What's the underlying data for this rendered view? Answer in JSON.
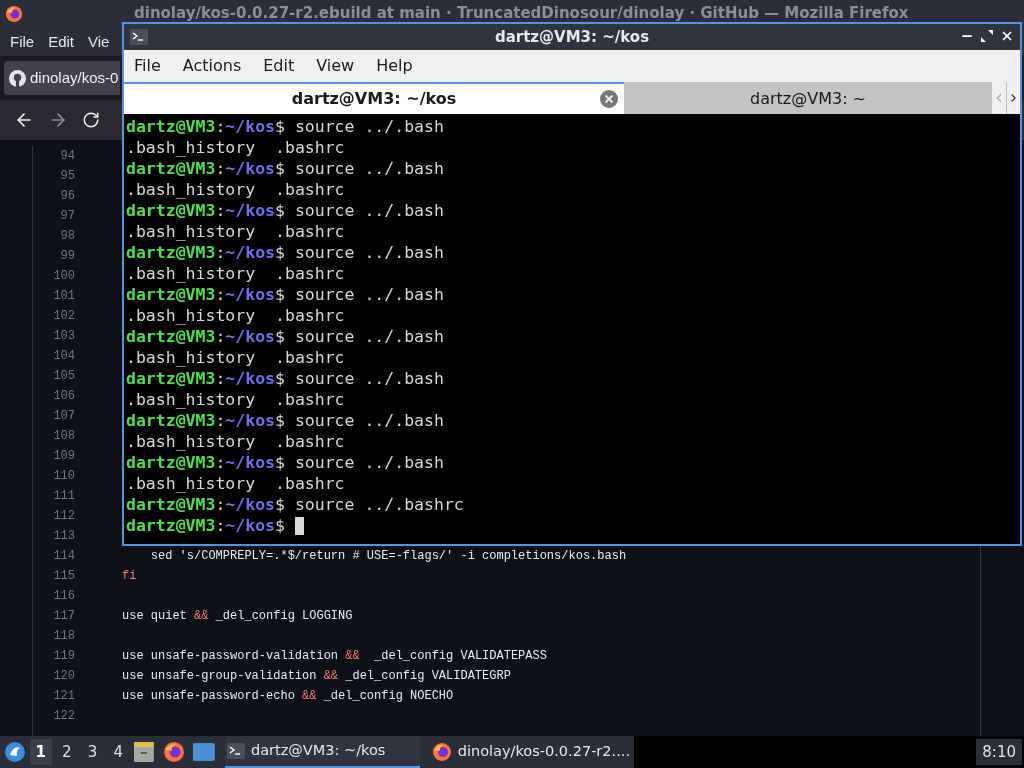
{
  "firefox": {
    "title": "dinolay/kos-0.0.27-r2.ebuild at main · TruncatedDinosour/dinolay · GitHub — Mozilla Firefox",
    "menu": [
      "File",
      "Edit",
      "Vie"
    ],
    "tab": {
      "title": "dinolay/kos-0"
    },
    "code": {
      "rows": [
        {
          "number": "94"
        },
        {
          "number": "95"
        },
        {
          "number": "96"
        },
        {
          "number": "97"
        },
        {
          "number": "98"
        },
        {
          "number": "99"
        },
        {
          "number": "100"
        },
        {
          "number": "101"
        },
        {
          "number": "102"
        },
        {
          "number": "103"
        },
        {
          "number": "104"
        },
        {
          "number": "105"
        },
        {
          "number": "106"
        },
        {
          "number": "107"
        },
        {
          "number": "108"
        },
        {
          "number": "109"
        },
        {
          "number": "110"
        },
        {
          "number": "111"
        },
        {
          "number": "112"
        },
        {
          "number": "113"
        },
        {
          "number": "114",
          "tokens": [
            {
              "kind": "plain",
              "text": "    sed 's/COMPREPLY=.*$/return # USE=-flags/' -i completions/kos.bash"
            }
          ]
        },
        {
          "number": "115",
          "tokens": [
            {
              "kind": "keyword",
              "text": "fi"
            }
          ]
        },
        {
          "number": "116"
        },
        {
          "number": "117",
          "tokens": [
            {
              "kind": "plain",
              "text": "use quiet "
            },
            {
              "kind": "keyword",
              "text": "&&"
            },
            {
              "kind": "plain",
              "text": " _del_config LOGGING"
            }
          ]
        },
        {
          "number": "118"
        },
        {
          "number": "119",
          "tokens": [
            {
              "kind": "plain",
              "text": "use unsafe-password-validation "
            },
            {
              "kind": "keyword",
              "text": "&&"
            },
            {
              "kind": "plain",
              "text": "  _del_config VALIDATEPASS"
            }
          ]
        },
        {
          "number": "120",
          "tokens": [
            {
              "kind": "plain",
              "text": "use unsafe-group-validation "
            },
            {
              "kind": "keyword",
              "text": "&&"
            },
            {
              "kind": "plain",
              "text": " _del_config VALIDATEGRP"
            }
          ]
        },
        {
          "number": "121",
          "tokens": [
            {
              "kind": "plain",
              "text": "use unsafe-password-echo "
            },
            {
              "kind": "keyword",
              "text": "&&"
            },
            {
              "kind": "plain",
              "text": " _del_config NOECHO"
            }
          ]
        },
        {
          "number": "122"
        }
      ]
    }
  },
  "terminal": {
    "title": "dartz@VM3: ~/kos",
    "menu": [
      "File",
      "Actions",
      "Edit",
      "View",
      "Help"
    ],
    "tabs": [
      {
        "label": "dartz@VM3: ~/kos",
        "selected": true
      },
      {
        "label": "dartz@VM3: ~",
        "selected": false
      }
    ],
    "lines": [
      {
        "kind": "prompt",
        "user": "dartz@VM3",
        "sep": ":",
        "path": "~/kos",
        "symbol": "$",
        "command": " source ../.bash",
        "cursor": false
      },
      {
        "kind": "output",
        "text": ".bash_history  .bashrc"
      },
      {
        "kind": "prompt",
        "user": "dartz@VM3",
        "sep": ":",
        "path": "~/kos",
        "symbol": "$",
        "command": " source ../.bash",
        "cursor": false
      },
      {
        "kind": "output",
        "text": ".bash_history  .bashrc"
      },
      {
        "kind": "prompt",
        "user": "dartz@VM3",
        "sep": ":",
        "path": "~/kos",
        "symbol": "$",
        "command": " source ../.bash",
        "cursor": false
      },
      {
        "kind": "output",
        "text": ".bash_history  .bashrc"
      },
      {
        "kind": "prompt",
        "user": "dartz@VM3",
        "sep": ":",
        "path": "~/kos",
        "symbol": "$",
        "command": " source ../.bash",
        "cursor": false
      },
      {
        "kind": "output",
        "text": ".bash_history  .bashrc"
      },
      {
        "kind": "prompt",
        "user": "dartz@VM3",
        "sep": ":",
        "path": "~/kos",
        "symbol": "$",
        "command": " source ../.bash",
        "cursor": false
      },
      {
        "kind": "output",
        "text": ".bash_history  .bashrc"
      },
      {
        "kind": "prompt",
        "user": "dartz@VM3",
        "sep": ":",
        "path": "~/kos",
        "symbol": "$",
        "command": " source ../.bash",
        "cursor": false
      },
      {
        "kind": "output",
        "text": ".bash_history  .bashrc"
      },
      {
        "kind": "prompt",
        "user": "dartz@VM3",
        "sep": ":",
        "path": "~/kos",
        "symbol": "$",
        "command": " source ../.bash",
        "cursor": false
      },
      {
        "kind": "output",
        "text": ".bash_history  .bashrc"
      },
      {
        "kind": "prompt",
        "user": "dartz@VM3",
        "sep": ":",
        "path": "~/kos",
        "symbol": "$",
        "command": " source ../.bash",
        "cursor": false
      },
      {
        "kind": "output",
        "text": ".bash_history  .bashrc"
      },
      {
        "kind": "prompt",
        "user": "dartz@VM3",
        "sep": ":",
        "path": "~/kos",
        "symbol": "$",
        "command": " source ../.bash",
        "cursor": false
      },
      {
        "kind": "output",
        "text": ".bash_history  .bashrc"
      },
      {
        "kind": "prompt",
        "user": "dartz@VM3",
        "sep": ":",
        "path": "~/kos",
        "symbol": "$",
        "command": " source ../.bashrc",
        "cursor": false
      },
      {
        "kind": "prompt",
        "user": "dartz@VM3",
        "sep": ":",
        "path": "~/kos",
        "symbol": "$",
        "cursor": true
      }
    ]
  },
  "taskbar": {
    "workspaces": [
      {
        "label": "1",
        "selected": true
      },
      {
        "label": "2",
        "selected": false
      },
      {
        "label": "3",
        "selected": false
      },
      {
        "label": "4",
        "selected": false
      }
    ],
    "tasks": [
      {
        "kind": "terminal",
        "label": "dartz@VM3: ~/kos",
        "selected": true
      },
      {
        "kind": "browser",
        "label": "dinolay/kos-0.0.27-r2....",
        "selected": false
      }
    ],
    "clock": "8:10"
  }
}
